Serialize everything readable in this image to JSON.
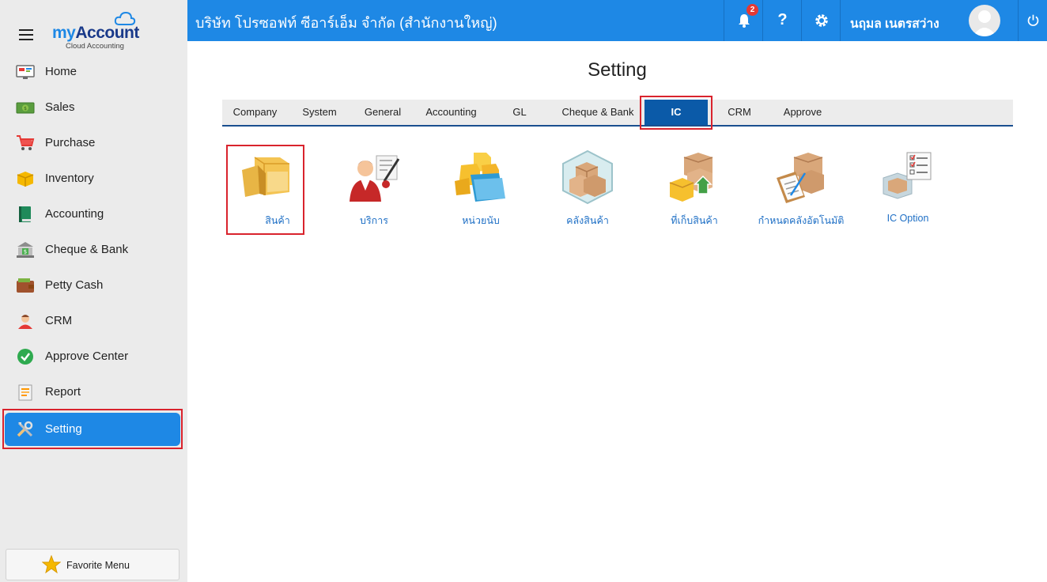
{
  "brand": {
    "name_part1": "my",
    "name_part2": "Account",
    "tagline": "Cloud Accounting"
  },
  "sidebar": {
    "items": [
      {
        "label": "Home",
        "icon": "home-monitor-icon"
      },
      {
        "label": "Sales",
        "icon": "cash-icon"
      },
      {
        "label": "Purchase",
        "icon": "cart-icon"
      },
      {
        "label": "Inventory",
        "icon": "box-icon"
      },
      {
        "label": "Accounting",
        "icon": "ledger-book-icon"
      },
      {
        "label": "Cheque & Bank",
        "icon": "bank-icon"
      },
      {
        "label": "Petty Cash",
        "icon": "wallet-icon"
      },
      {
        "label": "CRM",
        "icon": "people-icon"
      },
      {
        "label": "Approve Center",
        "icon": "check-circle-icon"
      },
      {
        "label": "Report",
        "icon": "report-icon"
      },
      {
        "label": "Setting",
        "icon": "tools-icon",
        "active": true
      }
    ],
    "favorite_label": "Favorite Menu"
  },
  "header": {
    "company": "บริษัท โปรซอฟท์ ซีอาร์เอ็ม จำกัด (สำนักงานใหญ่)",
    "notification_count": "2",
    "help_glyph": "?",
    "user_name": "นฤมล เนตรสว่าง"
  },
  "main": {
    "title": "Setting",
    "tabs": [
      "Company",
      "System",
      "General",
      "Accounting",
      "GL",
      "Cheque & Bank",
      "IC",
      "CRM",
      "Approve"
    ],
    "active_tab": "IC",
    "tiles": [
      {
        "label": "สินค้า",
        "icon": "product-boxes-icon"
      },
      {
        "label": "บริการ",
        "icon": "service-person-icon"
      },
      {
        "label": "หน่วยนับ",
        "icon": "unit-boxes-folder-icon"
      },
      {
        "label": "คลังสินค้า",
        "icon": "warehouse-icon"
      },
      {
        "label": "ที่เก็บสินค้า",
        "icon": "storage-location-icon"
      },
      {
        "label": "กำหนดคลังอัตโนมัติ",
        "icon": "auto-warehouse-icon"
      },
      {
        "label": "IC Option",
        "icon": "ic-option-checklist-icon"
      }
    ]
  },
  "colors": {
    "accent": "#1e88e5",
    "active_tab": "#0b5aa8",
    "highlight": "#d9232d",
    "sidebar_bg": "#ebebeb"
  }
}
